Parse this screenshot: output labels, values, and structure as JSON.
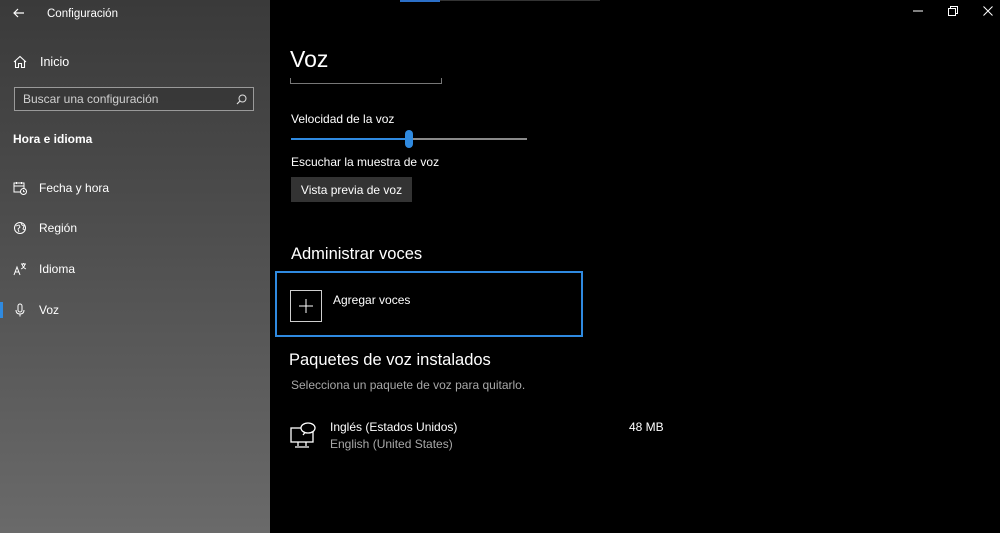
{
  "app": {
    "title": "Configuración"
  },
  "sidebar": {
    "home_label": "Inicio",
    "search": {
      "placeholder": "Buscar una configuración"
    },
    "section_title": "Hora e idioma",
    "items": [
      {
        "label": "Fecha y hora",
        "icon": "calendar-clock-icon"
      },
      {
        "label": "Región",
        "icon": "globe-region-icon"
      },
      {
        "label": "Idioma",
        "icon": "language-icon"
      },
      {
        "label": "Voz",
        "icon": "microphone-icon",
        "active": true
      }
    ]
  },
  "main": {
    "page_title": "Voz",
    "speed": {
      "label": "Velocidad de la voz",
      "value_fraction": 0.5
    },
    "listen_label": "Escuchar la muestra de voz",
    "preview_button": "Vista previa de voz",
    "manage_title": "Administrar voces",
    "add_voices_label": "Agregar voces",
    "installed": {
      "title": "Paquetes de voz instalados",
      "subtitle": "Selecciona un paquete de voz para quitarlo.",
      "packages": [
        {
          "name": "Inglés (Estados Unidos)",
          "locale": "English (United States)",
          "size": "48 MB"
        }
      ]
    }
  },
  "colors": {
    "accent": "#2f8ae0",
    "background": "#000000",
    "secondary_text": "#a8a8a8"
  }
}
